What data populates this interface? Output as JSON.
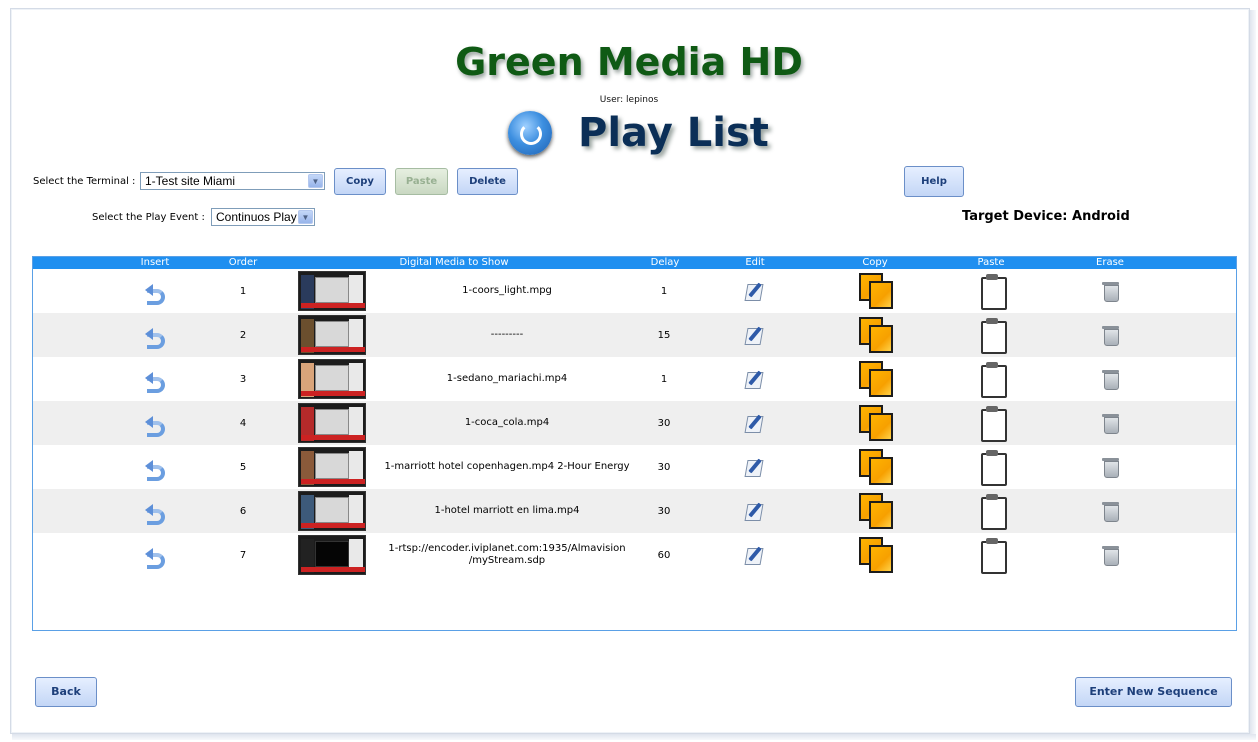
{
  "app": {
    "title": "Green Media HD",
    "user": "User: lepinos",
    "page_title": "Play List"
  },
  "controls": {
    "terminal_label": "Select the Terminal :",
    "terminal_value": "1-Test site Miami",
    "copy": "Copy",
    "paste": "Paste",
    "delete": "Delete",
    "help": "Help",
    "event_label": "Select the Play Event :",
    "event_value": "Continuos Play",
    "target_device": "Target Device: Android"
  },
  "table": {
    "headers": {
      "insert": "Insert",
      "order": "Order",
      "media": "Digital Media to Show",
      "delay": "Delay",
      "edit": "Edit",
      "copy": "Copy",
      "paste": "Paste",
      "erase": "Erase"
    },
    "rows": [
      {
        "order": "1",
        "media": "1-coors_light.mpg",
        "delay": "1"
      },
      {
        "order": "2",
        "media": "---------",
        "delay": "15"
      },
      {
        "order": "3",
        "media": "1-sedano_mariachi.mp4",
        "delay": "1"
      },
      {
        "order": "4",
        "media": "1-coca_cola.mp4",
        "delay": "30"
      },
      {
        "order": "5",
        "media": "1-marriott hotel copenhagen.mp4 2-Hour Energy",
        "delay": "30"
      },
      {
        "order": "6",
        "media": "1-hotel marriott en lima.mp4",
        "delay": "30"
      },
      {
        "order": "7",
        "media": "1-rtsp://encoder.iviplanet.com:1935/Almavision /myStream.sdp",
        "delay": "60"
      }
    ]
  },
  "footer": {
    "back": "Back",
    "enter_new": "Enter New Sequence"
  },
  "colors": {
    "title_green": "#0f5a14",
    "header_blue": "#1f8ff0",
    "button_blue": "#c3d6f6"
  }
}
